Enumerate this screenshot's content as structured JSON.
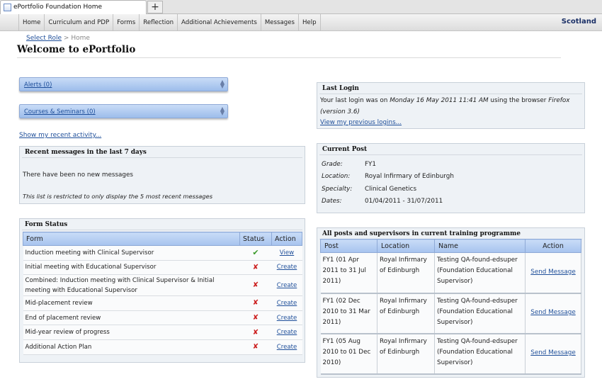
{
  "browser": {
    "tab_title": "ePortfolio Foundation Home",
    "new_tab_label": "+"
  },
  "nav": {
    "items": [
      "Home",
      "Curriculum and PDP",
      "Forms",
      "Reflection",
      "Additional Achievements",
      "Messages",
      "Help"
    ],
    "region": "Scotland"
  },
  "breadcrumb": {
    "link": "Select Role",
    "separator": ">",
    "current": "Home"
  },
  "page_title": "Welcome to ePortfolio",
  "alerts": {
    "label": "Alerts (0)"
  },
  "courses": {
    "label": "Courses & Seminars (0)"
  },
  "recent_activity_link": "Show my recent activity...",
  "recent_messages": {
    "title": "Recent messages in the last 7 days",
    "empty_text": "There have been no new messages",
    "note": "This list is restricted to only display the 5 most recent messages"
  },
  "form_status": {
    "title": "Form Status",
    "headers": [
      "Form",
      "Status",
      "Action"
    ],
    "rows": [
      {
        "form": "Induction meeting with Clinical Supervisor",
        "status": "done",
        "action": "View"
      },
      {
        "form": "Initial meeting with Educational Supervisor",
        "status": "pending",
        "action": "Create"
      },
      {
        "form": "Combined: Induction meeting with Clinical Supervisor & Initial meeting with Educational Supervisor",
        "status": "pending",
        "action": "Create"
      },
      {
        "form": "Mid-placement review",
        "status": "pending",
        "action": "Create"
      },
      {
        "form": "End of placement review",
        "status": "pending",
        "action": "Create"
      },
      {
        "form": "Mid-year review of progress",
        "status": "pending",
        "action": "Create"
      },
      {
        "form": "Additional Action Plan",
        "status": "pending",
        "action": "Create"
      }
    ]
  },
  "last_login": {
    "title": "Last Login",
    "prefix": "Your last login was on",
    "datetime": "Monday 16 May 2011 11:41 AM",
    "middle": "using the browser",
    "browser": "Firefox (version 3.6)",
    "link": "View my previous logins..."
  },
  "current_post": {
    "title": "Current Post",
    "fields": [
      {
        "label": "Grade:",
        "value": "FY1"
      },
      {
        "label": "Location:",
        "value": "Royal Infirmary of Edinburgh"
      },
      {
        "label": "Specialty:",
        "value": "Clinical Genetics"
      },
      {
        "label": "Dates:",
        "value": "01/04/2011 - 31/07/2011"
      }
    ]
  },
  "all_posts": {
    "title": "All posts and supervisors in current training programme",
    "headers": [
      "Post",
      "Location",
      "Name",
      "Action"
    ],
    "rows": [
      {
        "post": "FY1 (01 Apr 2011 to 31 Jul 2011)",
        "location": "Royal Infirmary of Edinburgh",
        "name": "Testing QA-found-edsuper (Foundation Educational Supervisor)",
        "action": "Send Message"
      },
      {
        "post": "FY1 (02 Dec 2010 to 31 Mar 2011)",
        "location": "Royal Infirmary of Edinburgh",
        "name": "Testing QA-found-edsuper (Foundation Educational Supervisor)",
        "action": "Send Message"
      },
      {
        "post": "FY1 (05 Aug 2010 to 01 Dec 2010)",
        "location": "Royal Infirmary of Edinburgh",
        "name": "Testing QA-found-edsuper (Foundation Educational Supervisor)",
        "action": "Send Message"
      }
    ]
  },
  "icons": {
    "done": "check-icon",
    "pending": "cross-icon",
    "collapse": "chevron-updown-icon"
  },
  "colors": {
    "header_blue": "#a6c3ee",
    "link": "#1f4f9a",
    "check": "#3a9a2a",
    "cross": "#cc2020",
    "region": "#1a2f66"
  }
}
